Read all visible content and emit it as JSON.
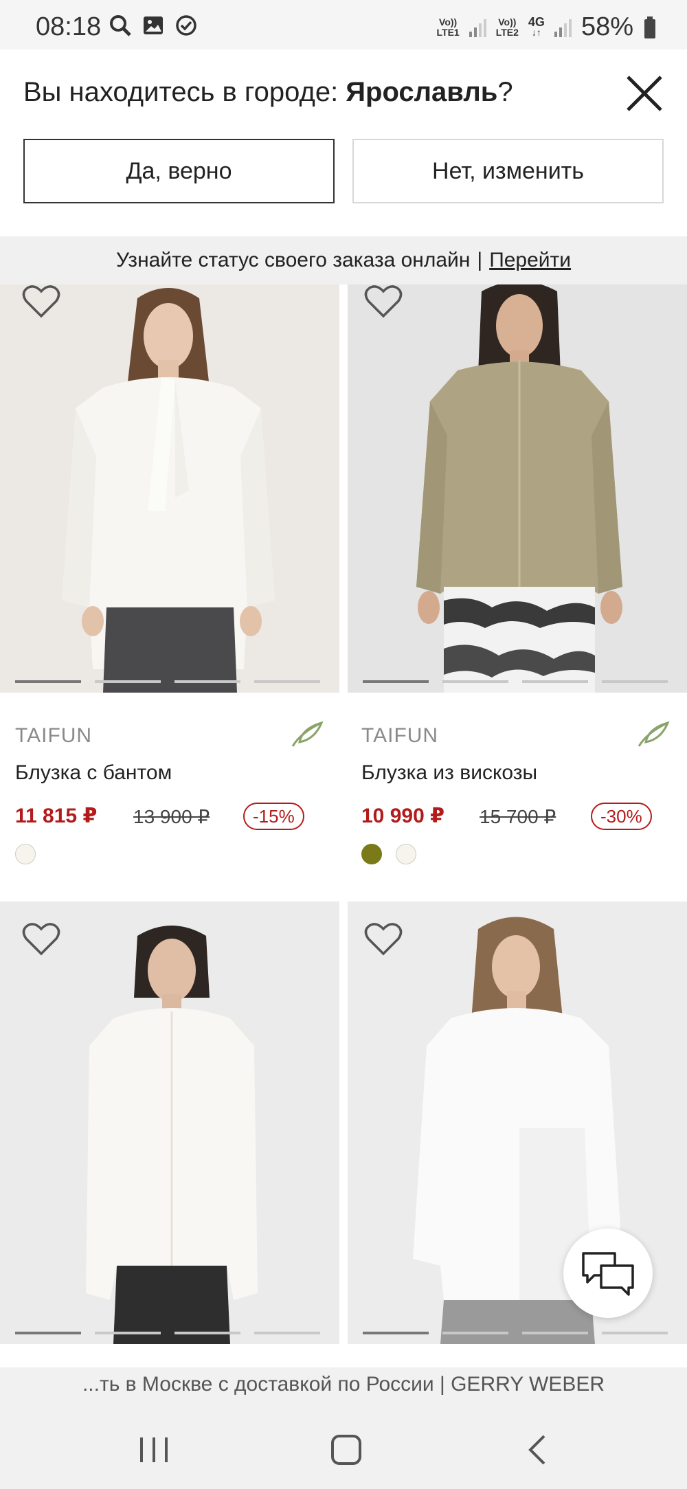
{
  "status_bar": {
    "time": "08:18",
    "net1_top": "Vo))",
    "net1_bottom": "LTE1",
    "net2_top": "Vo))",
    "net2_bottom": "LTE2",
    "net3_top": "4G",
    "net3_bottom": "↓↑",
    "battery": "58%"
  },
  "city_prompt": {
    "question_prefix": "Вы находитесь в городе: ",
    "city": "Ярославль",
    "question_suffix": "?",
    "confirm_label": "Да, верно",
    "change_label": "Нет, изменить"
  },
  "order_banner": {
    "text": "Узнайте статус своего заказа онлайн",
    "separator": "|",
    "link": "Перейти"
  },
  "products": [
    {
      "brand": "TAIFUN",
      "name": "Блузка с бантом",
      "price": "11 815 ₽",
      "old_price": "13 900 ₽",
      "discount": "-15%",
      "swatches": [
        "#f6f4ec"
      ]
    },
    {
      "brand": "TAIFUN",
      "name": "Блузка из вискозы",
      "price": "10 990 ₽",
      "old_price": "15 700 ₽",
      "discount": "-30%",
      "swatches": [
        "#7a7a18",
        "#f6f4ec"
      ]
    }
  ],
  "url_bar": {
    "text": "...ть в Москве с доставкой по России | GERRY WEBER"
  },
  "icons": {
    "status_left": [
      "search-icon",
      "image-icon",
      "check-circle-icon"
    ],
    "eco": "leaf-icon",
    "wishlist": "heart-icon",
    "chat": "chat-icon"
  },
  "colors": {
    "sale_red": "#b31b1b",
    "eco_green": "#8aa36b"
  }
}
